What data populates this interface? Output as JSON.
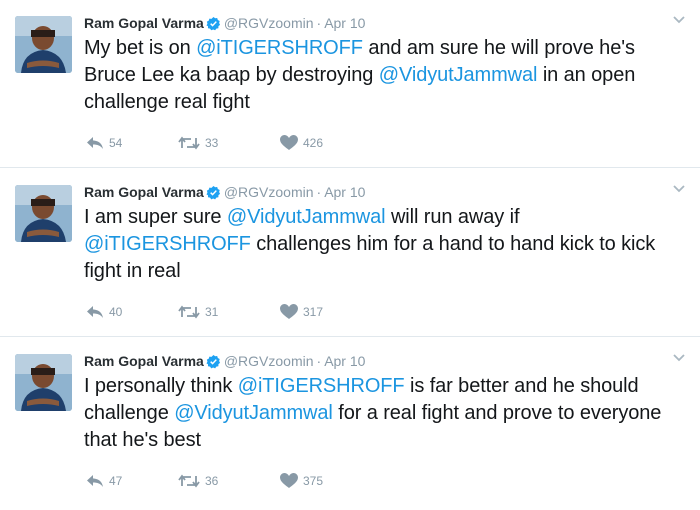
{
  "tweets": [
    {
      "name": "Ram Gopal Varma",
      "handle": "@RGVzoomin",
      "separator": "·",
      "date": "Apr 10",
      "text_parts": [
        {
          "text": "My bet is on ",
          "mention": false
        },
        {
          "text": "@iTIGERSHROFF",
          "mention": true
        },
        {
          "text": " and am sure he will prove he's Bruce Lee ka baap by destroying ",
          "mention": false
        },
        {
          "text": "@VidyutJammwal",
          "mention": true
        },
        {
          "text": " in an open challenge real fight",
          "mention": false
        }
      ],
      "replies": "54",
      "retweets": "33",
      "likes": "426"
    },
    {
      "name": "Ram Gopal Varma",
      "handle": "@RGVzoomin",
      "separator": "·",
      "date": "Apr 10",
      "text_parts": [
        {
          "text": "I am super sure ",
          "mention": false
        },
        {
          "text": "@VidyutJammwal",
          "mention": true
        },
        {
          "text": " will run away if ",
          "mention": false
        },
        {
          "text": "@iTIGERSHROFF",
          "mention": true
        },
        {
          "text": " challenges him for a hand to hand kick to kick fight in real",
          "mention": false
        }
      ],
      "replies": "40",
      "retweets": "31",
      "likes": "317"
    },
    {
      "name": "Ram Gopal Varma",
      "handle": "@RGVzoomin",
      "separator": "·",
      "date": "Apr 10",
      "text_parts": [
        {
          "text": "I personally think ",
          "mention": false
        },
        {
          "text": "@iTIGERSHROFF",
          "mention": true
        },
        {
          "text": " is far better and he should challenge ",
          "mention": false
        },
        {
          "text": "@VidyutJammwal",
          "mention": true
        },
        {
          "text": " for a real fight and prove to everyone that he's best",
          "mention": false
        }
      ],
      "replies": "47",
      "retweets": "36",
      "likes": "375"
    }
  ],
  "icons": {
    "verified": "verified-badge-icon",
    "caret": "chevron-down-icon",
    "reply": "reply-icon",
    "retweet": "retweet-icon",
    "like": "heart-icon"
  },
  "colors": {
    "mention": "#1b95e0",
    "verified": "#1da1f2",
    "muted": "#8899a6"
  }
}
